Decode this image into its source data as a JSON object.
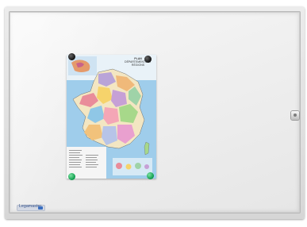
{
  "poster": {
    "title_line1": "PLAN",
    "title_line2": "DÉPARTEMENTS ET RÉGIONS"
  },
  "brand": {
    "label": "Legamaster"
  },
  "colors": {
    "frame": "#d9d9d9",
    "board": "#f0f0f0",
    "sea": "#8fc3e8",
    "magnet_black": "#1a1a1a",
    "magnet_green": "#18b45e"
  }
}
